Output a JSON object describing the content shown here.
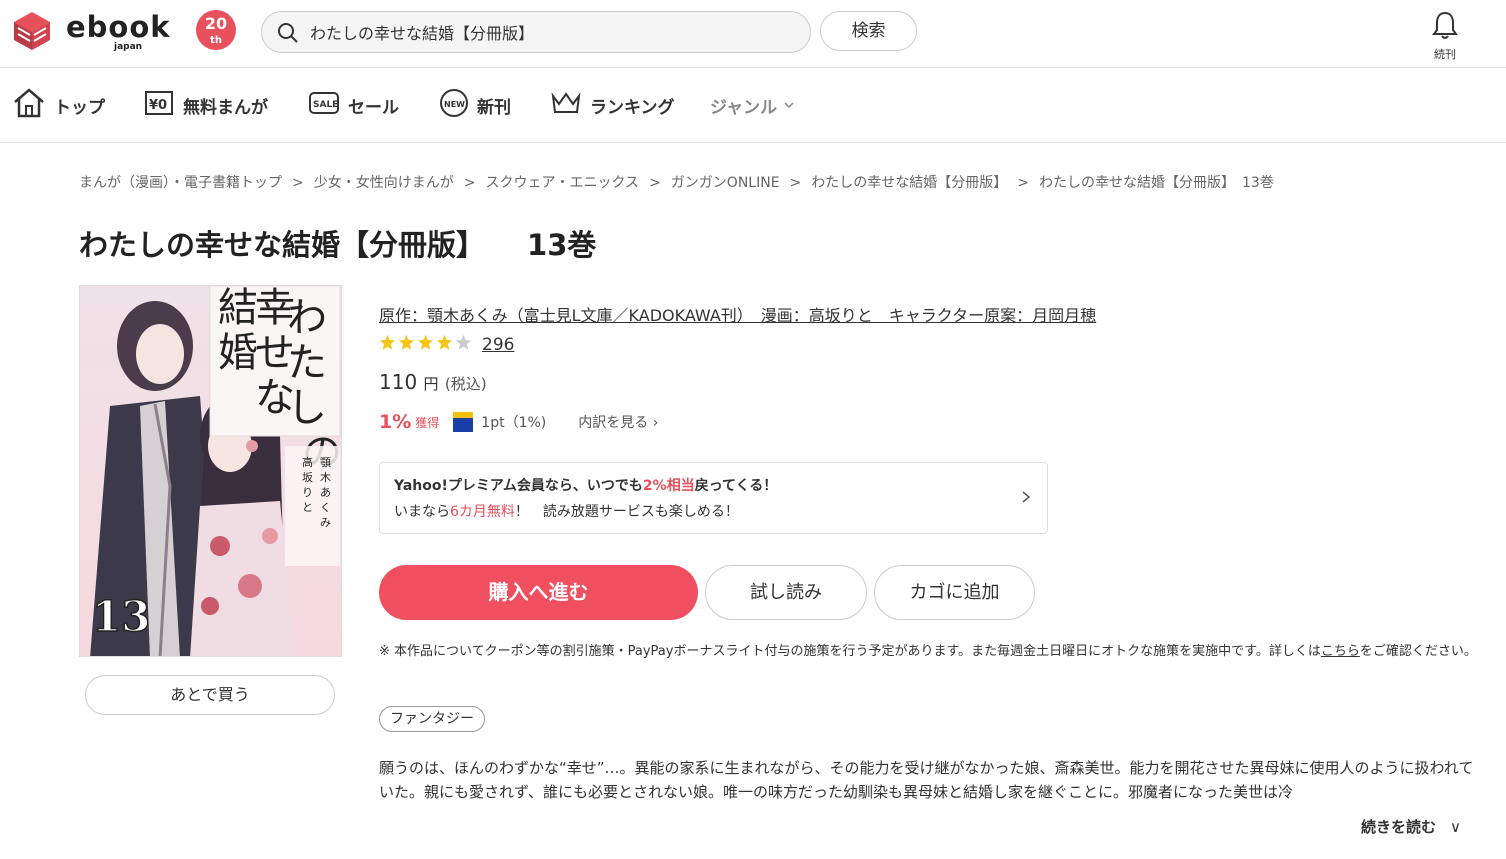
{
  "header": {
    "logo_text": "ebook",
    "logo_sub": "japan",
    "logo_badge_number": "20",
    "logo_badge_suffix": "th",
    "search_value": "わたしの幸せな結婚【分冊版】",
    "search_button": "検索",
    "bell_label": "続刊"
  },
  "nav": {
    "items": [
      {
        "label": "トップ",
        "icon": "home-icon"
      },
      {
        "label": "無料まんが",
        "icon": "yen-zero-icon"
      },
      {
        "label": "セール",
        "icon": "sale-icon"
      },
      {
        "label": "新刊",
        "icon": "new-icon"
      },
      {
        "label": "ランキング",
        "icon": "crown-icon"
      },
      {
        "label": "ジャンル",
        "icon": "chevron-down-icon"
      }
    ]
  },
  "breadcrumb": [
    "まんが（漫画）・電子書籍トップ",
    "少女・女性向けまんが",
    "スクウェア・エニックス",
    "ガンガンONLINE",
    "わたしの幸せな結婚【分冊版】",
    "わたしの幸せな結婚【分冊版】　13巻"
  ],
  "breadcrumb_sep": ">",
  "title": {
    "main": "わたしの幸せな結婚【分冊版】",
    "volume": "13巻"
  },
  "cover": {
    "title_text": "わたしの幸せな結婚",
    "volume_number": "13",
    "colors": {
      "bg": "#f3e6ea",
      "kimono": "#3c3a4a",
      "hair": "#3a2d3c",
      "accent": "#c85a6a"
    }
  },
  "later_button": "あとで買う",
  "authors": "原作：顎木あくみ（富士見L文庫／KADOKAWA刊）　漫画：高坂りと　キャラクター原案：月岡月穂",
  "rating": {
    "stars": 4,
    "max": 5,
    "count": "296",
    "star_color": "#f5c518",
    "empty_color": "#cccccc"
  },
  "price": {
    "value": "110",
    "unit": "円",
    "tax": "(税込)"
  },
  "points": {
    "percent": "1%",
    "percent_label": "獲得",
    "t_point": "1pt（1%)",
    "breakdown": "内訳を見る"
  },
  "promo": {
    "line1_pre": "Yahoo!プレミアム会員なら、いつでも",
    "line1_red": "2%相当",
    "line1_post": "戻ってくる！",
    "line2_pre": "いまなら",
    "line2_red": "6カ月無料",
    "line2_post": "！　読み放題サービスも楽しめる！"
  },
  "buttons": {
    "buy": "購入へ進む",
    "trial": "試し読み",
    "cart": "カゴに追加"
  },
  "notice": {
    "text": "※ 本作品についてクーポン等の割引施策・PayPayボーナスライト付与の施策を行う予定があります。また毎週金土日曜日にオトクな施策を実施中です。詳しくは",
    "link": "こちら",
    "tail": "をご確認ください。"
  },
  "tag": "ファンタジー",
  "description": "願うのは、ほんのわずかな“幸せ”…。異能の家系に生まれながら、その能力を受け継がなかった娘、斎森美世。能力を開花させた異母妹に使用人のように扱われていた。親にも愛されず、誰にも必要とされない娘。唯一の味方だった幼馴染も異母妹と結婚し家を継ぐことに。邪魔者になった美世は冷",
  "read_more": "続きを読む",
  "colors": {
    "accent": "#f04f5f",
    "badge": "#e8505b"
  }
}
